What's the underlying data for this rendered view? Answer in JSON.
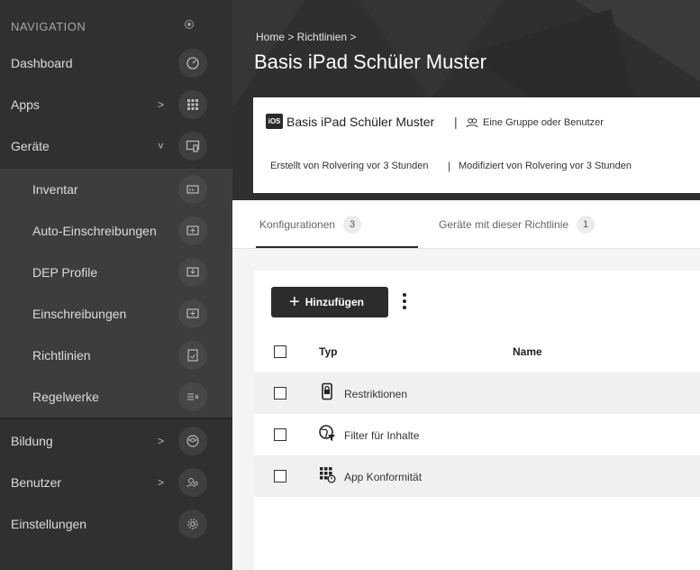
{
  "sidebar": {
    "header": "NAVIGATION",
    "items": [
      {
        "label": "Dashboard",
        "chevron": "",
        "icon": "gauge-icon"
      },
      {
        "label": "Apps",
        "chevron": ">",
        "icon": "grid-icon"
      },
      {
        "label": "Geräte",
        "chevron": "˅",
        "icon": "devices-icon"
      }
    ],
    "subitems": [
      {
        "label": "Inventar",
        "icon": "inventory-icon"
      },
      {
        "label": "Auto-Einschreibungen",
        "icon": "auto-enroll-icon"
      },
      {
        "label": "DEP Profile",
        "icon": "dep-profile-icon"
      },
      {
        "label": "Einschreibungen",
        "icon": "enrollment-icon"
      },
      {
        "label": "Richtlinien",
        "icon": "policy-icon"
      },
      {
        "label": "Regelwerke",
        "icon": "rules-icon"
      }
    ],
    "bottom": [
      {
        "label": "Bildung",
        "chevron": ">",
        "icon": "education-icon"
      },
      {
        "label": "Benutzer",
        "chevron": ">",
        "icon": "users-icon"
      },
      {
        "label": "Einstellungen",
        "chevron": "",
        "icon": "settings-gear-icon"
      }
    ]
  },
  "header": {
    "breadcrumb": "Home > Richtlinien >",
    "title": "Basis iPad Schüler Muster"
  },
  "info": {
    "badge": "iOS",
    "name": "Basis iPad Schüler Muster",
    "separator": "|",
    "group": "Eine Gruppe oder Benutzer",
    "created": "Erstellt von Rolvering vor 3 Stunden",
    "modified": "Modifiziert von Rolvering vor 3 Stunden"
  },
  "tabs": [
    {
      "label": "Konfigurationen",
      "count": "3",
      "active": true
    },
    {
      "label": "Geräte mit dieser Richtlinie",
      "count": "1",
      "active": false
    }
  ],
  "toolbar": {
    "add_label": "Hinzufügen",
    "add_glyph": "+"
  },
  "table": {
    "columns": [
      "Typ",
      "Name"
    ],
    "rows": [
      {
        "label": "Restriktionen",
        "icon": "restriction-icon"
      },
      {
        "label": "Filter für Inhalte",
        "icon": "content-filter-icon"
      },
      {
        "label": "App Konformität",
        "icon": "app-compliance-icon"
      }
    ]
  },
  "colors": {
    "sidebar_bg": "#303030",
    "sidebar_sub_bg": "#3d3d3d",
    "header_bg": "#2f2f2f",
    "button_bg": "#2c2c2c",
    "row_alt_bg": "#f0f0f0"
  }
}
